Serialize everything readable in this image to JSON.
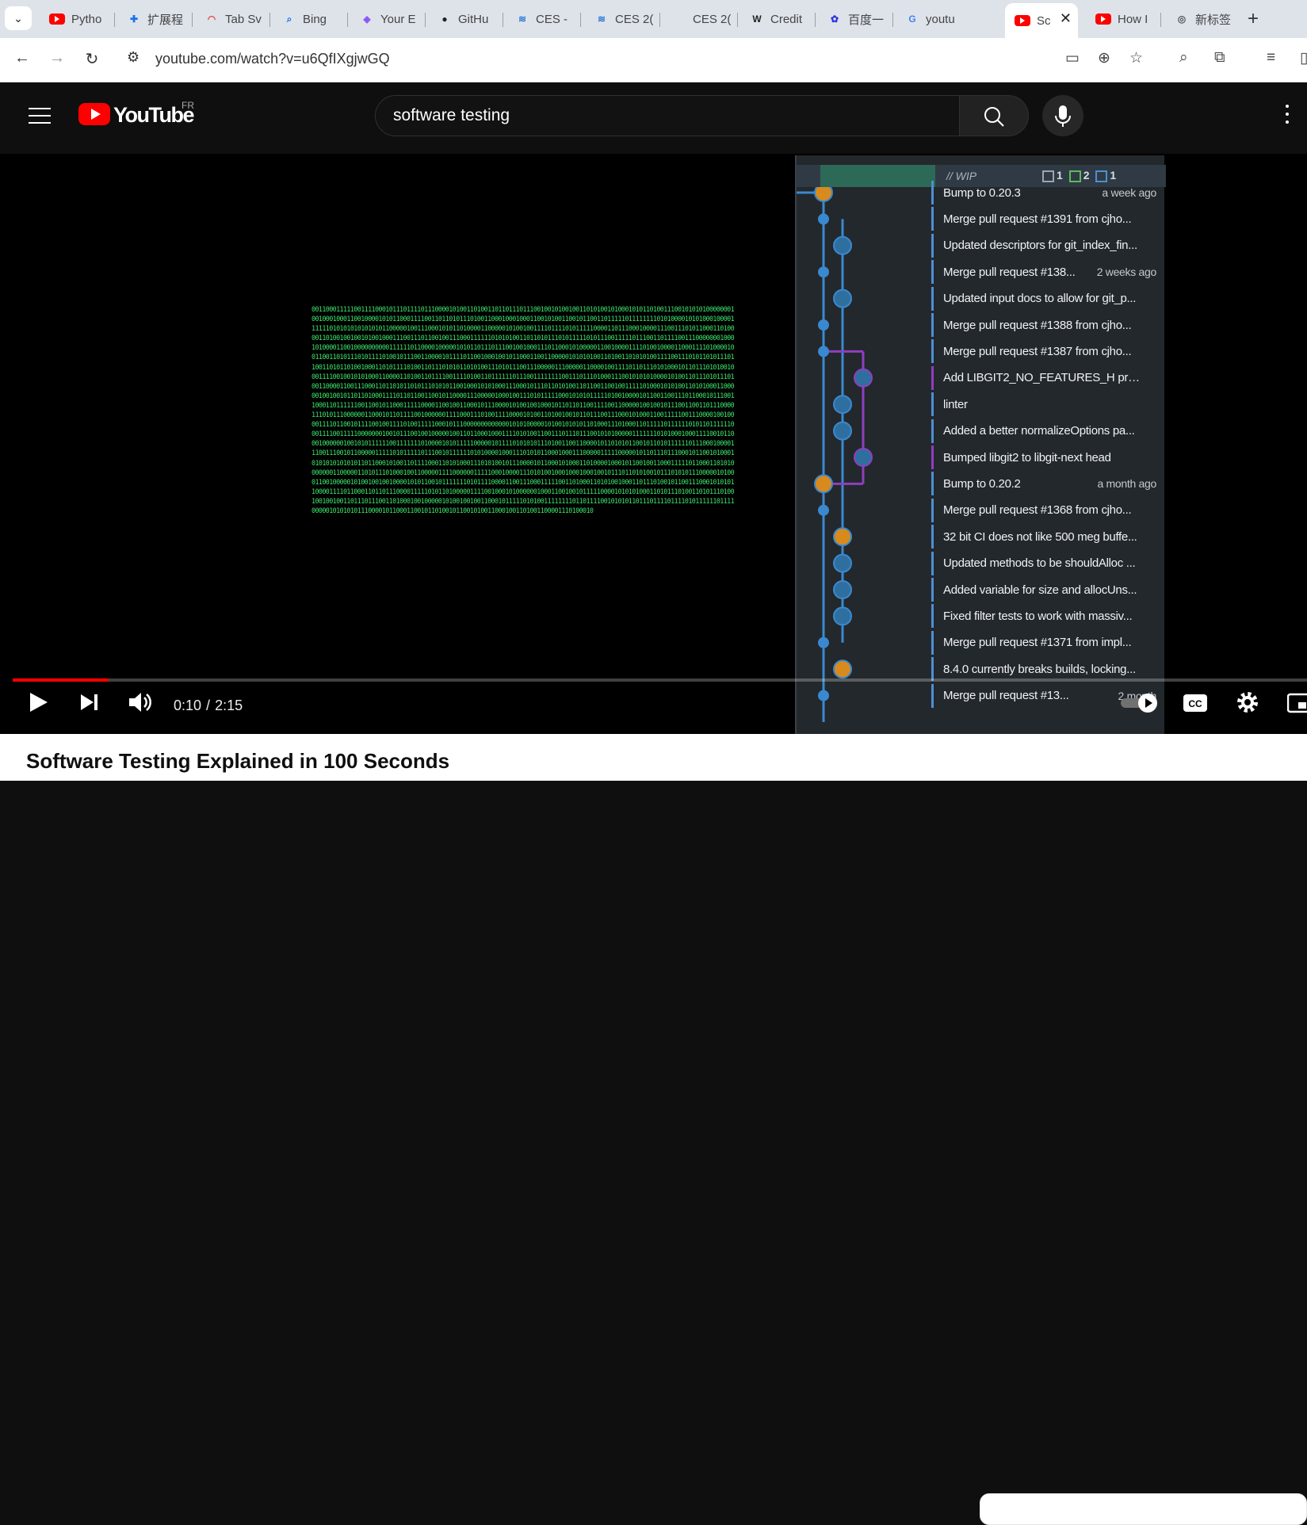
{
  "browser": {
    "tabs": [
      {
        "label": "Pytho",
        "favicon": "youtube-icon"
      },
      {
        "label": "扩展程",
        "favicon": "extension-puzzle-icon"
      },
      {
        "label": "Tab Sv",
        "favicon": "rainbow-icon"
      },
      {
        "label": "Bing",
        "favicon": "search-icon"
      },
      {
        "label": "Your E",
        "favicon": "copilot-icon"
      },
      {
        "label": "GitHu",
        "favicon": "github-icon"
      },
      {
        "label": "CES -",
        "favicon": "ces-icon"
      },
      {
        "label": "CES 2(",
        "favicon": "ces-icon"
      },
      {
        "label": "CES 2(",
        "favicon": "blank-icon"
      },
      {
        "label": "Credit",
        "favicon": "wikipedia-icon"
      },
      {
        "label": "百度一",
        "favicon": "baidu-icon"
      },
      {
        "label": "youtu",
        "favicon": "google-icon"
      },
      {
        "label": "Sc",
        "favicon": "youtube-icon",
        "active": true
      },
      {
        "label": "How I",
        "favicon": "youtube-icon"
      },
      {
        "label": "新标签",
        "favicon": "chrome-icon"
      }
    ],
    "new_tab": "+",
    "close": "✕",
    "url": "youtube.com/watch?v=u6QfIXgjwGQ"
  },
  "youtube": {
    "logo_text": "YouTube",
    "region": "FR",
    "search_query": "software testing",
    "video_title": "Software Testing Explained in 100 Seconds"
  },
  "player": {
    "time_current": "0:10",
    "time_separator": "/",
    "time_total": "2:15",
    "progress_fraction": 0.074,
    "accent": "#ff0000"
  },
  "git_panel": {
    "wip_label": "// WIP",
    "stat_modified": "1",
    "stat_added": "2",
    "stat_renamed": "1",
    "commits": [
      {
        "msg": "Bump to 0.20.3",
        "time": "a week ago"
      },
      {
        "msg": "Merge pull request #1391 from cjho...",
        "time": ""
      },
      {
        "msg": "Updated descriptors for git_index_fin...",
        "time": ""
      },
      {
        "msg": "Merge pull request #138...",
        "time": "2 weeks ago"
      },
      {
        "msg": "Updated input docs to allow for git_p...",
        "time": ""
      },
      {
        "msg": "Merge pull request #1388 from cjho...",
        "time": ""
      },
      {
        "msg": "Merge pull request #1387 from cjho...",
        "time": ""
      },
      {
        "msg": "Add LIBGIT2_NO_FEATURES_H prepr...",
        "time": ""
      },
      {
        "msg": "linter",
        "time": ""
      },
      {
        "msg": "Added a better normalizeOptions pa...",
        "time": ""
      },
      {
        "msg": "Bumped libgit2 to libgit-next head",
        "time": ""
      },
      {
        "msg": "Bump to 0.20.2",
        "time": "a month ago"
      },
      {
        "msg": "Merge pull request #1368 from cjho...",
        "time": ""
      },
      {
        "msg": "32 bit CI does not like 500 meg buffe...",
        "time": ""
      },
      {
        "msg": "Updated methods to be shouldAlloc ...",
        "time": ""
      },
      {
        "msg": "Added variable for size and allocUns...",
        "time": ""
      },
      {
        "msg": "Fixed filter tests to work with massiv...",
        "time": ""
      },
      {
        "msg": "Merge pull request #1371 from impl...",
        "time": ""
      },
      {
        "msg": "8.4.0 currently breaks builds, locking...",
        "time": ""
      },
      {
        "msg": "Merge pull request #13...",
        "time": "2 month"
      }
    ]
  }
}
